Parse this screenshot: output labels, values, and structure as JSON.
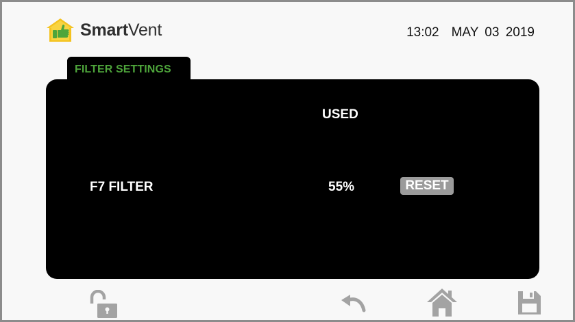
{
  "header": {
    "brand_bold": "Smart",
    "brand_regular": "Vent",
    "time": "13:02",
    "date": "MAY 03 2019"
  },
  "tab": {
    "label": "FILTER SETTINGS"
  },
  "table": {
    "column_header": "USED",
    "rows": [
      {
        "name": "F7 FILTER",
        "used": "55%",
        "reset_label": "RESET"
      }
    ]
  },
  "bottom_bar": {
    "icons": [
      "unlock-icon",
      "back-icon",
      "home-icon",
      "save-icon"
    ]
  },
  "colors": {
    "accent_green": "#4ea53b",
    "panel": "#000000",
    "icon_gray": "#a3a3a3"
  }
}
